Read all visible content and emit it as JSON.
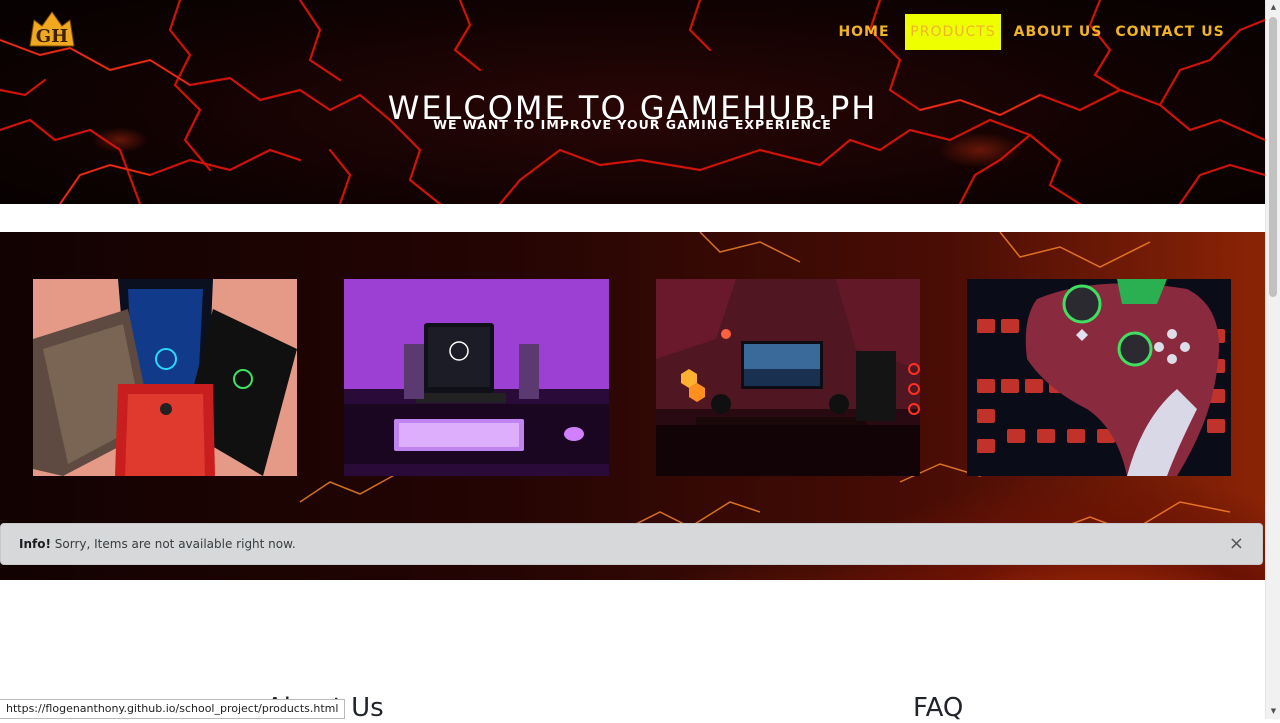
{
  "brand": {
    "logo_text": "GH"
  },
  "nav": {
    "items": [
      {
        "label": "HOME"
      },
      {
        "label": "PRODUCTS"
      },
      {
        "label": "ABOUT US"
      },
      {
        "label": "CONTACT US"
      }
    ],
    "active_index": 1
  },
  "hero": {
    "title": "WELCOME TO GAMEHUB.PH",
    "subtitle": "WE WANT TO IMPROVE YOUR GAMING EXPERIENCE"
  },
  "products": {
    "images": [
      {
        "icon": "gaming-phones-image"
      },
      {
        "icon": "laptop-setup-image"
      },
      {
        "icon": "pc-setup-image"
      },
      {
        "icon": "controller-image"
      }
    ]
  },
  "alert": {
    "strong": "Info!",
    "message": "Sorry, Items are not available right now.",
    "close": "×"
  },
  "sections": {
    "about_heading": "About Us",
    "faq_heading": "FAQ"
  },
  "status_bar": {
    "url": "https://flogenanthony.github.io/school_project/products.html"
  },
  "colors": {
    "nav_text": "#f0b429",
    "nav_active_bg": "#eeff00",
    "crack_red": "#e0160c"
  }
}
